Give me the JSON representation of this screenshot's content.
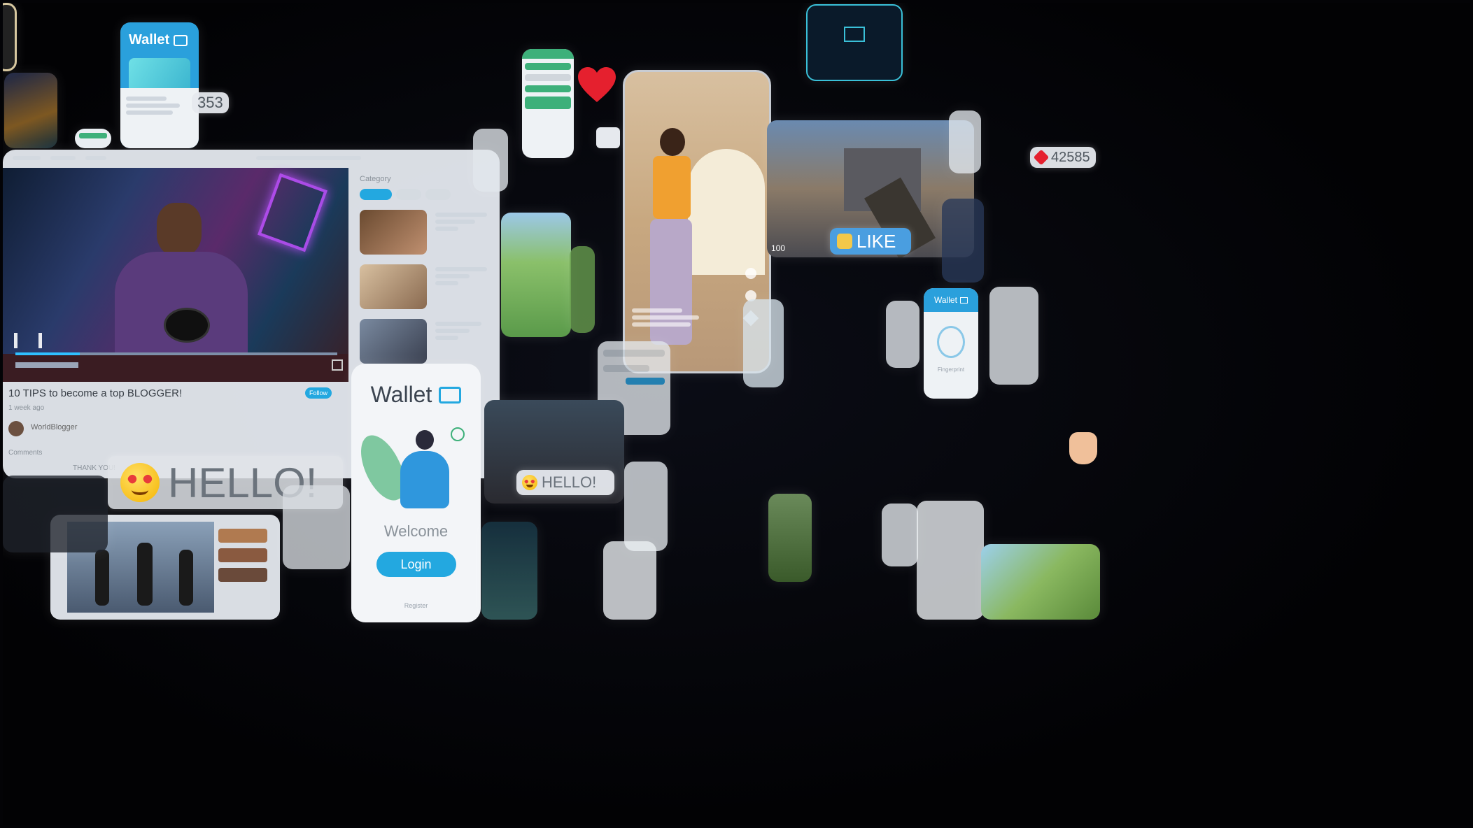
{
  "colors": {
    "accent": "#23a8e0",
    "heart": "#e5202e",
    "background": "#030306"
  },
  "video": {
    "title": "10 TIPS to become a top BLOGGER!",
    "meta": "1 week ago",
    "channel": "WorldBlogger",
    "follow_label": "Follow",
    "comments_label": "Comments",
    "comment_preview": "THANK YOU!",
    "category_title": "Category"
  },
  "wallet_main": {
    "title": "Wallet",
    "welcome": "Welcome",
    "login_label": "Login",
    "register_label": "Register"
  },
  "wallet_small_top": {
    "title": "Wallet"
  },
  "wallet_small_right": {
    "title": "Wallet",
    "caption": "Fingerprint"
  },
  "badges": {
    "count_left": "353",
    "likes_right": "42585"
  },
  "stickers": {
    "hello_big": "HELLO!",
    "hello_small": "HELLO!",
    "like": "LIKE"
  },
  "game": {
    "hud_number": "100"
  },
  "icons": [
    "heart-icon",
    "wallet-icon",
    "thumbs-up-icon",
    "play-pause-icon",
    "fullscreen-icon",
    "love-eyes-emoji-icon",
    "fingerprint-icon",
    "send-icon"
  ]
}
